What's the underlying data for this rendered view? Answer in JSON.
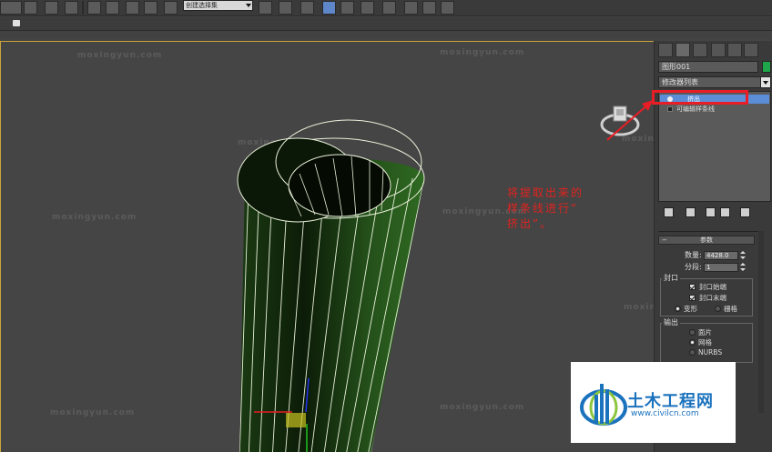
{
  "toolbar": {
    "selection_set_placeholder": "创建选择集",
    "icons": [
      "select-icon",
      "move-icon",
      "rotate-icon",
      "snap-icon",
      "angle-snap-icon",
      "percent-snap-icon",
      "spinner-snap-icon",
      "edit-named-selection-icon",
      "mirror-icon",
      "align-icon",
      "layer-icon",
      "curve-editor-icon",
      "schematic-view-icon",
      "material-editor-icon",
      "render-setup-icon",
      "render-frame-icon",
      "render-icon"
    ]
  },
  "viewport": {
    "watermarks": [
      "moxingyun.com",
      "moxingyun.com",
      "moxingyun.com",
      "moxingyun.com",
      "moxingyun.com",
      "moxingyun.com",
      "moxingyun.com",
      "moxingyun.com",
      "moxingyun.com"
    ],
    "annotation_lines": [
      "将提取出来的",
      "样条线进行“",
      "挤出”。"
    ],
    "accent_annotation": "#e0231f"
  },
  "command_panel": {
    "object_name": "图形001",
    "object_color": "#1fa64a",
    "modifier_list_label": "修改器列表",
    "stack_items": [
      {
        "label": "挤出",
        "selected": true
      },
      {
        "label": "可编辑样条线",
        "selected": false
      }
    ],
    "parameters_title": "参数",
    "amount_label": "数量:",
    "amount_value": "4428.0",
    "segments_label": "分段:",
    "segments_value": "1",
    "capping_title": "封口",
    "cap_start_label": "封口始端",
    "cap_end_label": "封口末端",
    "morph_label": "变形",
    "grid_label": "栅格",
    "output_title": "输出",
    "output_options": [
      "面片",
      "网格",
      "NURBS"
    ],
    "output_selected": "网格"
  },
  "logo": {
    "title": "土木工程网",
    "url": "www.civilcn.com"
  }
}
